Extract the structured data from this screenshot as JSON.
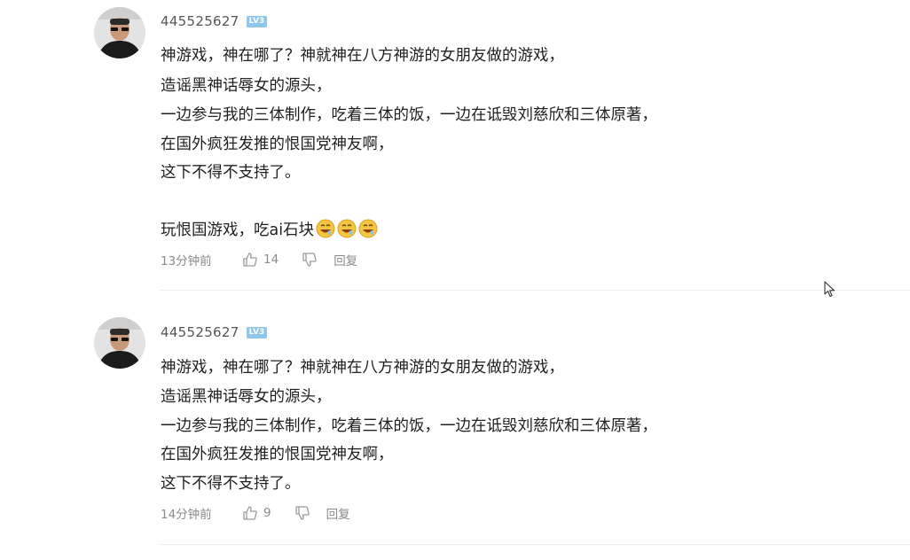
{
  "comments": [
    {
      "username": "445525627",
      "level": "LV3",
      "lines": [
        "神游戏，神在哪了？神就神在八方神游的女朋友做的游戏，",
        "造谣黑神话辱女的源头，",
        "一边参与我的三体制作，吃着三体的饭，一边在诋毁刘慈欣和三体原著，",
        "在国外疯狂发推的恨国党神友啊，",
        "这下不得不支持了。",
        "",
        "玩恨国游戏，吃ai石块"
      ],
      "emoji": [
        "grinning-drooling-emoji",
        "grinning-drooling-emoji",
        "grinning-drooling-emoji"
      ],
      "time": "13分钟前",
      "likes": "14",
      "reply_label": "回复"
    },
    {
      "username": "445525627",
      "level": "LV3",
      "lines": [
        "神游戏，神在哪了？神就神在八方神游的女朋友做的游戏，",
        "造谣黑神话辱女的源头，",
        "一边参与我的三体制作，吃着三体的饭，一边在诋毁刘慈欣和三体原著，",
        "在国外疯狂发推的恨国党神友啊，",
        "这下不得不支持了。"
      ],
      "time": "14分钟前",
      "likes": "9",
      "reply_label": "回复"
    }
  ],
  "colors": {
    "text": "#1f1f1f",
    "meta": "#8a8a8a",
    "badge": "#8ec6ec",
    "divider": "#eeeeee"
  }
}
